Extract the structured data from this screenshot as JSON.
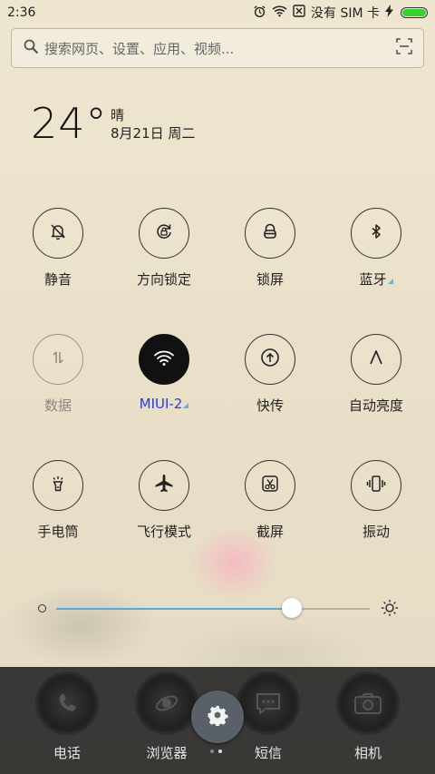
{
  "status_bar": {
    "time": "2:36",
    "no_sim": "没有 SIM 卡",
    "battery_level": 1.0,
    "icons": [
      "alarm-icon",
      "wifi-icon",
      "sim-x-icon",
      "charging-icon",
      "battery-icon"
    ]
  },
  "search": {
    "placeholder": "搜索网页、设置、应用、视频...",
    "icons": [
      "search-icon",
      "scan-icon"
    ]
  },
  "weather": {
    "temperature": "24°",
    "condition": "晴",
    "date": "8月21日 周二"
  },
  "toggles": [
    {
      "label": "静音",
      "icon": "bell-off-icon",
      "state": "off"
    },
    {
      "label": "方向锁定",
      "icon": "rotation-lock-icon",
      "state": "off"
    },
    {
      "label": "锁屏",
      "icon": "lock-icon",
      "state": "off"
    },
    {
      "label": "蓝牙",
      "icon": "bluetooth-icon",
      "state": "off",
      "has_more": true
    },
    {
      "label": "数据",
      "icon": "data-arrows-icon",
      "state": "disabled"
    },
    {
      "label": "MIUI-2",
      "icon": "wifi-icon",
      "state": "on",
      "has_more": true
    },
    {
      "label": "快传",
      "icon": "upload-icon",
      "state": "off"
    },
    {
      "label": "自动亮度",
      "icon": "auto-brightness-icon",
      "state": "off"
    },
    {
      "label": "手电筒",
      "icon": "flashlight-icon",
      "state": "off"
    },
    {
      "label": "飞行模式",
      "icon": "airplane-icon",
      "state": "off"
    },
    {
      "label": "截屏",
      "icon": "screenshot-icon",
      "state": "off"
    },
    {
      "label": "振动",
      "icon": "vibrate-icon",
      "state": "off"
    }
  ],
  "brightness": {
    "level": 0.75
  },
  "dock": {
    "apps": [
      {
        "label": "电话",
        "icon": "phone-icon"
      },
      {
        "label": "浏览器",
        "icon": "browser-icon"
      },
      {
        "label": "短信",
        "icon": "message-icon"
      },
      {
        "label": "相机",
        "icon": "camera-icon"
      }
    ]
  },
  "settings_button": {
    "icon": "gear-icon"
  },
  "page_indicator": {
    "pages": 2,
    "current": 2
  },
  "colors": {
    "background": "#ece2cc",
    "accent_active_label": "#2a3be0",
    "slider_fill": "#5fa8d3",
    "battery": "#3ad12f",
    "dock": "#262626"
  }
}
